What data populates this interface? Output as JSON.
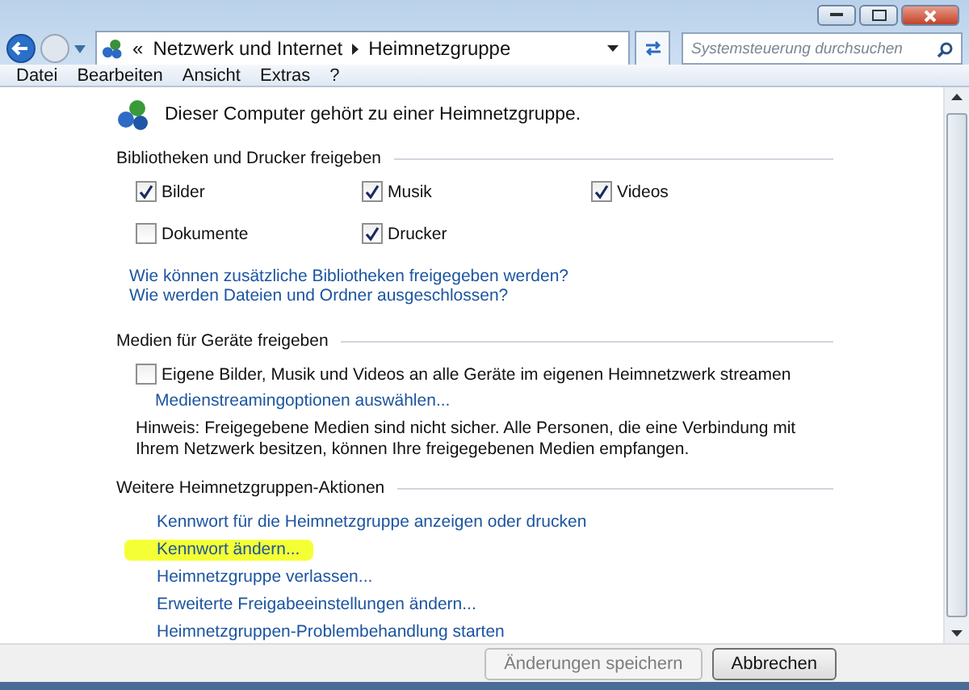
{
  "address_bar": {
    "breadcrumbs": [
      "«",
      "Netzwerk und Internet",
      "Heimnetzgruppe"
    ]
  },
  "search": {
    "placeholder": "Systemsteuerung durchsuchen"
  },
  "menu": [
    "Datei",
    "Bearbeiten",
    "Ansicht",
    "Extras",
    "?"
  ],
  "status_text": "Dieser Computer gehört zu einer Heimnetzgruppe.",
  "libraries": {
    "heading": "Bibliotheken und Drucker freigeben",
    "items": [
      {
        "label": "Bilder",
        "checked": true
      },
      {
        "label": "Musik",
        "checked": true
      },
      {
        "label": "Videos",
        "checked": true
      },
      {
        "label": "Dokumente",
        "checked": false
      },
      {
        "label": "Drucker",
        "checked": true
      }
    ],
    "links": [
      "Wie können zusätzliche Bibliotheken freigegeben werden?",
      "Wie werden Dateien und Ordner ausgeschlossen?"
    ]
  },
  "media": {
    "heading": "Medien für Geräte freigeben",
    "stream": {
      "label": "Eigene Bilder, Musik und Videos an alle Geräte im eigenen Heimnetzwerk streamen",
      "checked": false
    },
    "link": "Medienstreamingoptionen auswählen...",
    "note": "Hinweis: Freigegebene Medien sind nicht sicher. Alle Personen, die eine Verbindung mit Ihrem Netzwerk besitzen, können Ihre freigegebenen Medien empfangen."
  },
  "actions": {
    "heading": "Weitere Heimnetzgruppen-Aktionen",
    "links": [
      {
        "label": "Kennwort für die Heimnetzgruppe anzeigen oder drucken",
        "highlighted": false
      },
      {
        "label": "Kennwort ändern...",
        "highlighted": true
      },
      {
        "label": "Heimnetzgruppe verlassen...",
        "highlighted": false
      },
      {
        "label": "Erweiterte Freigabeeinstellungen ändern...",
        "highlighted": false
      },
      {
        "label": "Heimnetzgruppen-Problembehandlung starten",
        "highlighted": false
      }
    ]
  },
  "buttons": [
    {
      "label": "Änderungen speichern",
      "disabled": true
    },
    {
      "label": "Abbrechen",
      "disabled": false
    }
  ]
}
